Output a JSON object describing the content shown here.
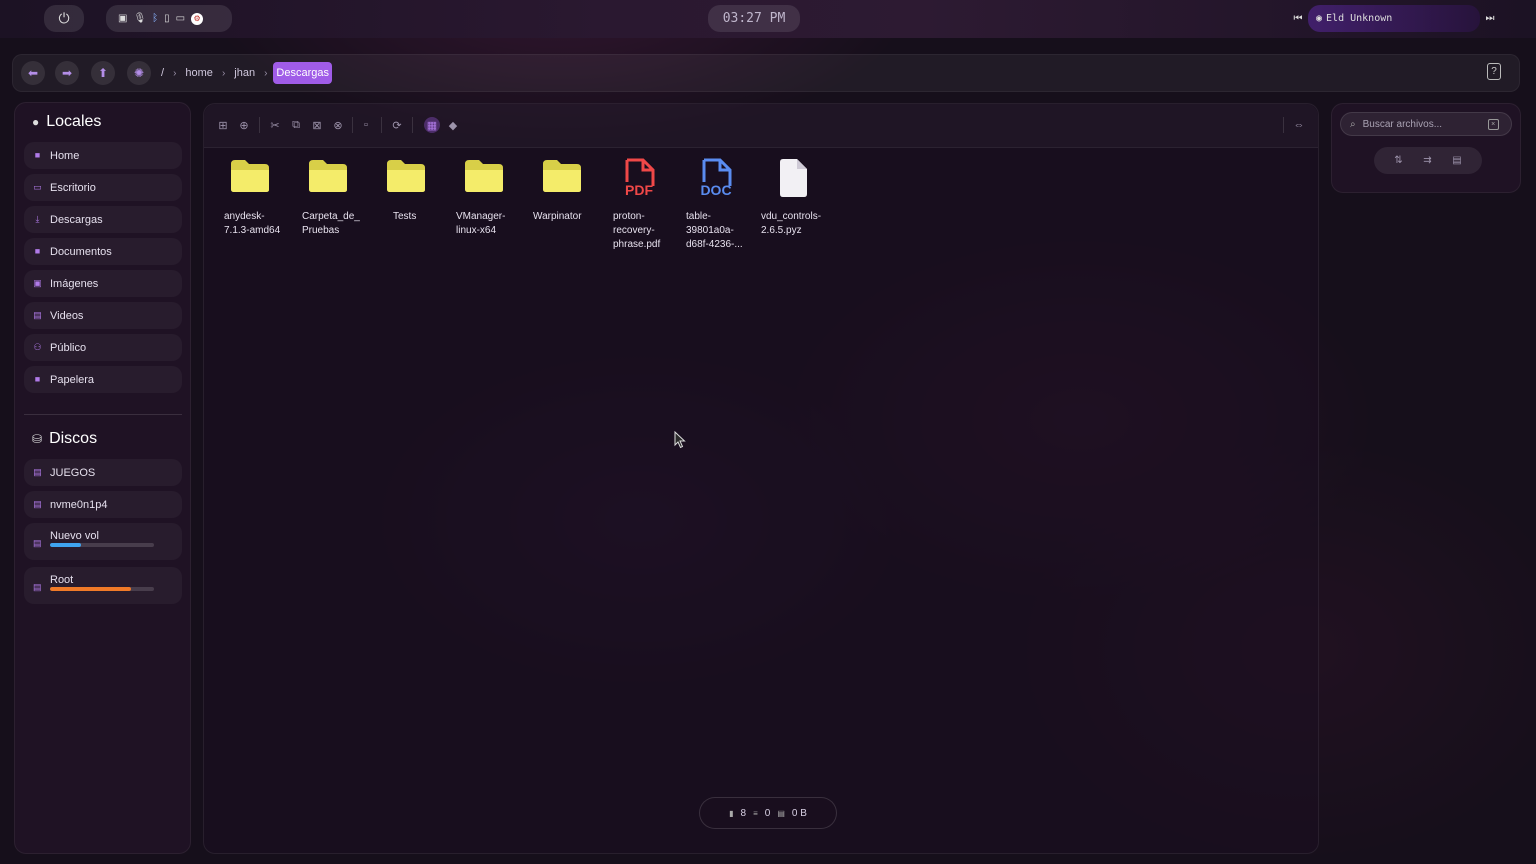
{
  "topbar": {
    "clock": "03:27 PM",
    "media": {
      "track": "Eld Unknown",
      "prev_icon": "skip-back-icon",
      "next_icon": "skip-forward-icon"
    },
    "tray_icons": [
      "chat-icon",
      "microphone-icon",
      "bluetooth-icon",
      "phone-icon",
      "monitor-icon",
      "steam-icon"
    ]
  },
  "nav": {
    "breadcrumbs": [
      "/",
      "home",
      "jhan",
      "Descargas"
    ],
    "active_index": 3
  },
  "sidebar": {
    "locales_title": "Locales",
    "items": [
      {
        "label": "Home",
        "icon": "home-icon"
      },
      {
        "label": "Escritorio",
        "icon": "desktop-icon"
      },
      {
        "label": "Descargas",
        "icon": "download-icon"
      },
      {
        "label": "Documentos",
        "icon": "document-icon"
      },
      {
        "label": "Imágenes",
        "icon": "image-icon"
      },
      {
        "label": "Videos",
        "icon": "video-icon"
      },
      {
        "label": "Público",
        "icon": "people-icon"
      },
      {
        "label": "Papelera",
        "icon": "trash-icon"
      }
    ],
    "discos_title": "Discos",
    "disks": [
      {
        "label": "JUEGOS"
      },
      {
        "label": "nvme0n1p4"
      },
      {
        "label": "Nuevo vol",
        "usage": 0.3,
        "color": "#3fa4f0"
      },
      {
        "label": "Root",
        "usage": 0.78,
        "color": "#f07a28"
      }
    ]
  },
  "files": [
    {
      "name": "anydesk-7.1.3-amd64",
      "type": "folder"
    },
    {
      "name": "Carpeta_de_ Pruebas",
      "type": "folder"
    },
    {
      "name": "Tests",
      "type": "folder"
    },
    {
      "name": "VManager-linux-x64",
      "type": "folder"
    },
    {
      "name": "Warpinator",
      "type": "folder"
    },
    {
      "name": "proton-recovery-phrase.pdf",
      "type": "pdf",
      "badge": "PDF"
    },
    {
      "name": "table-39801a0a-d68f-4236-...",
      "type": "doc",
      "badge": "DOC"
    },
    {
      "name": "vdu_controls-2.6.5.pyz",
      "type": "file"
    }
  ],
  "status": {
    "files": "8",
    "selected": "0",
    "size": "0 B"
  },
  "search": {
    "placeholder": "Buscar archivos..."
  },
  "colors": {
    "accent": "#a05ce8",
    "folder": "#f4ec6a",
    "pdf": "#f04848",
    "doc": "#5a8cf0"
  }
}
